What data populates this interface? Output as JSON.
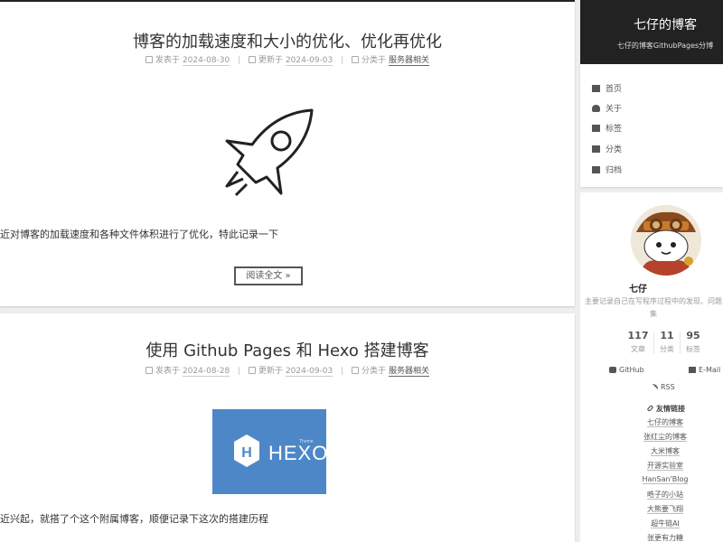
{
  "posts": [
    {
      "title": "博客的加载速度和大小的优化、优化再优化",
      "posted_label": "发表于",
      "posted_date": "2024-08-30",
      "updated_label": "更新于",
      "updated_date": "2024-09-03",
      "category_label": "分类于",
      "category": "服务器相关",
      "image_icon": "rocket-icon",
      "excerpt": "近对博客的加载速度和各种文件体积进行了优化，特此记录一下",
      "read_more": "阅读全文 »"
    },
    {
      "title": "使用 Github Pages 和 Hexo 搭建博客",
      "posted_label": "发表于",
      "posted_date": "2024-08-28",
      "updated_label": "更新于",
      "updated_date": "2024-09-03",
      "category_label": "分类于",
      "category": "服务器相关",
      "image_logo_text": "HEXO",
      "image_logo_small": "Theme",
      "excerpt": "近兴起，就搭了个这个附属博客，顺便记录下这次的搭建历程"
    }
  ],
  "sidebar": {
    "site_name": "七仔的博客",
    "site_subtitle": "七仔的博客GithubPages分博",
    "menu": [
      {
        "label": "首页",
        "icon": "home-icon"
      },
      {
        "label": "关于",
        "icon": "user-icon"
      },
      {
        "label": "标签",
        "icon": "tags-icon"
      },
      {
        "label": "分类",
        "icon": "th-icon"
      },
      {
        "label": "归档",
        "icon": "archive-icon"
      }
    ],
    "author": "七仔",
    "description": "主要记录自己在写程序过程中的发现、问题",
    "description_cont": "集",
    "stats": [
      {
        "count": "117",
        "label": "文章"
      },
      {
        "count": "11",
        "label": "分类"
      },
      {
        "count": "95",
        "label": "标签"
      }
    ],
    "social": [
      {
        "label": "GitHub",
        "icon": "github-icon"
      },
      {
        "label": "E-Mail",
        "icon": "envelope-icon"
      }
    ],
    "rss": "RSS",
    "links_title": "友情链接",
    "links": [
      "七仔的博客",
      "张红尘的博客",
      "大米博客",
      "开源实验室",
      "HanSan'Blog",
      "晧子的小站",
      "大熊要飞翔",
      "超牛链AI",
      "张更有力糖"
    ]
  }
}
